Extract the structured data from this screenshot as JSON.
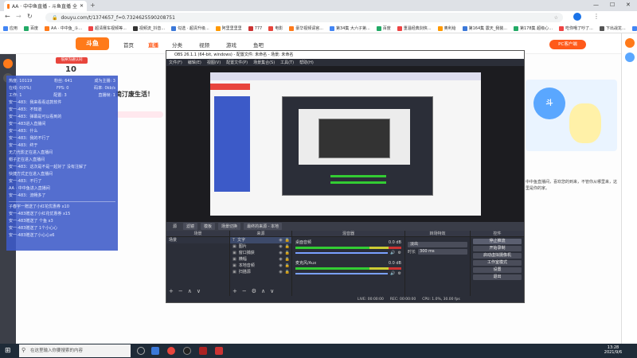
{
  "browser": {
    "tab_title": "AA · 中中鱼直播 - 斗鱼直播 全",
    "new_tab_icon": "plus",
    "url": "douyu.com/t/1374657_f=0.7324625590208751",
    "bookmarks": [
      "应用",
      "百度",
      "AA · 中中鱼_斗...",
      "超清赛车视频等...",
      "视频流_抖音...",
      "勾选 · 超清升级...",
      "阿里里里里",
      "777",
      "电影",
      "豪华视频请官...",
      "第34集 大六子第...",
      "百度",
      "重温经典剑侠...",
      "奥利给",
      "第164集 震天_我装...",
      "第178集 超级心…",
      "吃你哦了吵了...",
      "下出战龙...",
      "阅读列表"
    ]
  },
  "site": {
    "logo": "斗鱼",
    "nav": [
      "首页",
      "直播",
      "分类",
      "视频",
      "游戏",
      "鱼吧"
    ],
    "room_number": "10",
    "room_badge": "低掉沟通认同",
    "stream_title": "简汀废生活！",
    "pc_client": "PC客户端",
    "right_text": "中中鱼直播间，喜欢您的到来，不管你从哪里来，这里是你的家。"
  },
  "stats_panel": {
    "header": [
      [
        "热度: 10119",
        "粉丝: 641",
        "成为主播: 3"
      ],
      [
        "在线: 0(0%)",
        "FPS: 0",
        "码率: 0kb/s"
      ],
      [
        "工作: 1",
        "配置: 3",
        "直播帧: 1"
      ]
    ],
    "messages": [
      "安一-483：我来看看这款软件",
      "安一-483：不知道",
      "安一-483：弹幕是可以看到的",
      "安一-483进入直播间",
      "安一-483：什么",
      "安一-483：我的不行了",
      "安一-483：终于",
      "无力光影正在进入直播间",
      "帽子正在进入直播间",
      "安一-483：这次是不是一起好了 没有注解了",
      "快捷方式正在进入直播间",
      "安一-483：不行了",
      "AA · 中中鱼进入直播间",
      "安一-483：流畅多了"
    ],
    "gifts": [
      "子春宇一赠送了小红花优惠券 x10",
      "安一-483赠送了小红花优惠券 x15",
      "安一-483赠送了 个鱼 x3",
      "安一-483赠送了 1个小心心",
      "安一-483赠送了小心心x6"
    ]
  },
  "obs": {
    "title": "OBS 26.1.1 (64-bit, windows) - 配置文件: 未命名 - 场景: 未命名",
    "menu": [
      "文件(F)",
      "编辑(E)",
      "视图(V)",
      "配置文件(P)",
      "场景集合(S)",
      "工具(T)",
      "帮助(H)"
    ],
    "scene_bar": [
      "源",
      "滤镜",
      "模板",
      "场景切换",
      "最终的来源 - 本地"
    ],
    "docks": {
      "scenes": {
        "title": "场景",
        "items": [
          "场景"
        ]
      },
      "sources": {
        "title": "来源",
        "items": [
          "文字",
          "图片",
          "窗口捕获",
          "横幅",
          "本地音频",
          "扫描源"
        ]
      },
      "mixer": {
        "title": "混音器",
        "tracks": [
          {
            "name": "桌面音频",
            "db": "0.0 dB"
          },
          {
            "name": "麦克风/Aux",
            "db": "0.0 dB"
          }
        ]
      },
      "transitions": {
        "title": "转场特效",
        "type": "淡出",
        "duration_label": "时长",
        "duration": "300 ms"
      },
      "controls": {
        "title": "控件",
        "buttons": [
          "停止推流",
          "开始录制",
          "启动虚拟摄像机",
          "工作室模式",
          "设置",
          "退出"
        ]
      }
    },
    "status": {
      "live": "LIVE: 00:00:00",
      "rec": "REC: 00:00:00",
      "cpu": "CPU: 1.0%, 30.00 fps"
    }
  },
  "taskbar": {
    "search_placeholder": "在这里输入你要搜索的内容",
    "time": "13:28",
    "date": "2021/9/6"
  },
  "colors": {
    "accent_red": "#e8453c",
    "panel_blue": "#3c5ac8",
    "obs_bg": "#2b2e38",
    "douyu_orange": "#ff7a1a"
  }
}
